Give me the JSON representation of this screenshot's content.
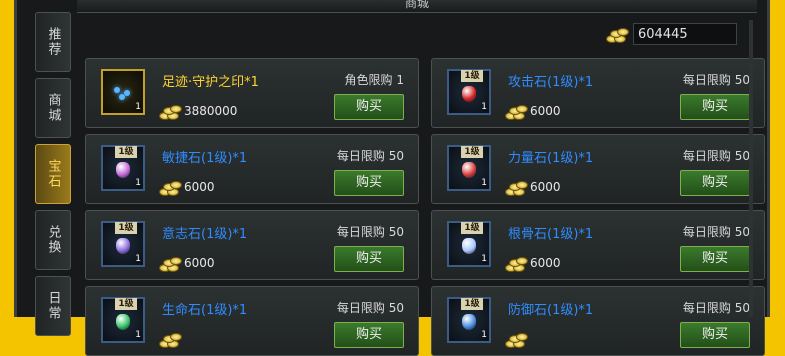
{
  "window": {
    "title": "商城"
  },
  "tabs": [
    {
      "label": "推荐",
      "active": false
    },
    {
      "label": "商城",
      "active": false
    },
    {
      "label": "宝石",
      "active": true
    },
    {
      "label": "兑换",
      "active": false
    },
    {
      "label": "日常",
      "active": false
    }
  ],
  "currency": {
    "icon": "gold-coins-icon",
    "value": "604445"
  },
  "items": [
    {
      "name": "足迹·守护之印*1",
      "name_color": "#ffd22e",
      "limit": "角色限购 1",
      "price": "3880000",
      "buy_label": "购买",
      "qty": "1",
      "level_badge": "",
      "icon": "footprint-seal-icon",
      "gem_color": ""
    },
    {
      "name": "攻击石(1级)*1",
      "name_color": "#2f8cff",
      "limit": "每日限购 50",
      "price": "6000",
      "buy_label": "购买",
      "qty": "1",
      "level_badge": "1级",
      "icon": "attack-stone-icon",
      "gem_color": "#d62828"
    },
    {
      "name": "敏捷石(1级)*1",
      "name_color": "#2f8cff",
      "limit": "每日限购 50",
      "price": "6000",
      "buy_label": "购买",
      "qty": "1",
      "level_badge": "1级",
      "icon": "agility-stone-icon",
      "gem_color": "#c46ad8"
    },
    {
      "name": "力量石(1级)*1",
      "name_color": "#2f8cff",
      "limit": "每日限购 50",
      "price": "6000",
      "buy_label": "购买",
      "qty": "1",
      "level_badge": "1级",
      "icon": "strength-stone-icon",
      "gem_color": "#d83f3f"
    },
    {
      "name": "意志石(1级)*1",
      "name_color": "#2f8cff",
      "limit": "每日限购 50",
      "price": "6000",
      "buy_label": "购买",
      "qty": "1",
      "level_badge": "1级",
      "icon": "will-stone-icon",
      "gem_color": "#8f6ee0"
    },
    {
      "name": "根骨石(1级)*1",
      "name_color": "#2f8cff",
      "limit": "每日限购 50",
      "price": "6000",
      "buy_label": "购买",
      "qty": "1",
      "level_badge": "1级",
      "icon": "root-bone-stone-icon",
      "gem_color": "#a9c9ff"
    },
    {
      "name": "生命石(1级)*1",
      "name_color": "#2f8cff",
      "limit": "每日限购 50",
      "price": "",
      "buy_label": "购买",
      "qty": "1",
      "level_badge": "1级",
      "icon": "life-stone-icon",
      "gem_color": "#35c46a"
    },
    {
      "name": "防御石(1级)*1",
      "name_color": "#2f8cff",
      "limit": "每日限购 50",
      "price": "",
      "buy_label": "购买",
      "qty": "1",
      "level_badge": "1级",
      "icon": "defense-stone-icon",
      "gem_color": "#4a8fe0"
    }
  ]
}
